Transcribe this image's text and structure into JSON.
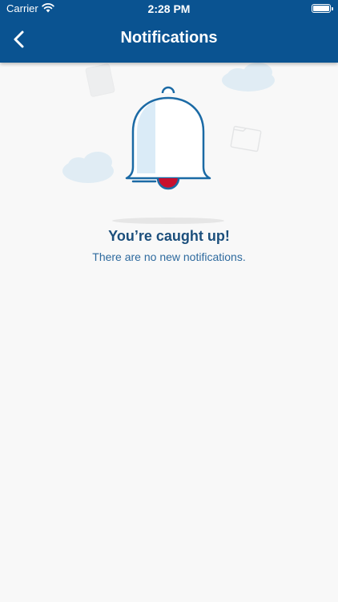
{
  "status_bar": {
    "carrier": "Carrier",
    "time": "2:28 PM",
    "wifi_icon": "wifi-icon",
    "battery_icon": "battery-icon"
  },
  "header": {
    "title": "Notifications",
    "back_icon": "chevron-left-icon",
    "background_color": "#0a5391"
  },
  "empty_state": {
    "title": "You’re caught up!",
    "subtitle": "There are no new notifications.",
    "illustration_icon": "bell-icon",
    "accent_color": "#c8102e"
  }
}
